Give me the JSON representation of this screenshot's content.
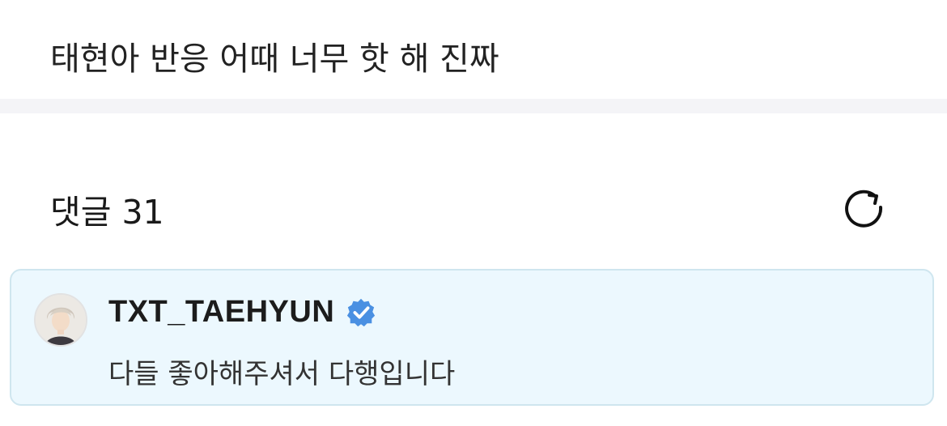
{
  "post": {
    "text": "태현아 반응 어때 너무 핫 해 진짜"
  },
  "comments": {
    "header_label": "댓글 31",
    "refresh_icon": "refresh-icon"
  },
  "pinned_comment": {
    "author": "TXT_TAEHYUN",
    "verified_icon": "verified-badge-icon",
    "text": "다들 좋아해주셔서 다행입니다",
    "card_background": "#ecf8fe",
    "card_border": "#cfe6ef",
    "verified_color": "#4a90e2"
  }
}
